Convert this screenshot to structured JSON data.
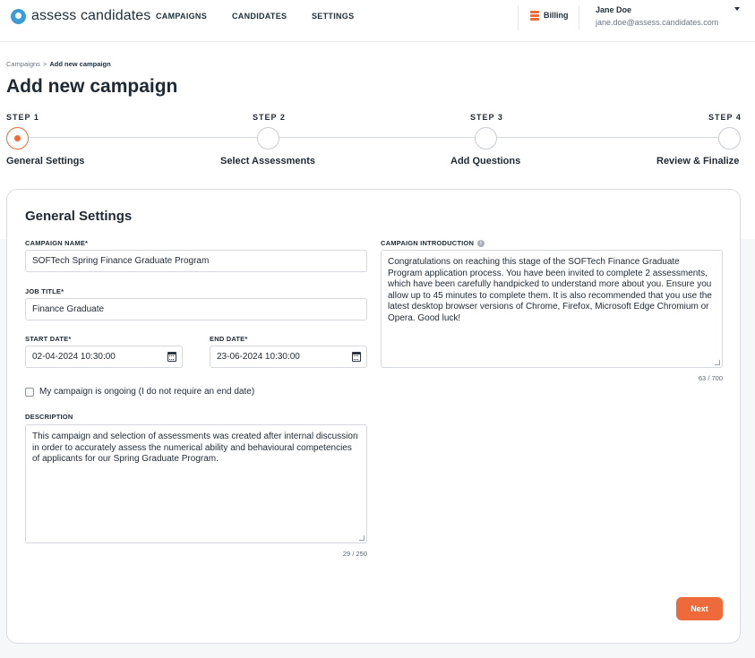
{
  "header": {
    "logo_text": "assess candidates",
    "nav": [
      "CAMPAIGNS",
      "CANDIDATES",
      "SETTINGS"
    ],
    "billing_label": "Billing",
    "user_name": "Jane Doe",
    "user_email": "jane.doe@assess.candidates.com",
    "accent_color": "#ef6a3a",
    "logo_color": "#3d9bd8"
  },
  "breadcrumb": {
    "parent": "Campaigns",
    "separator": ">",
    "current": "Add new campaign"
  },
  "page_title": "Add new campaign",
  "stepper": {
    "steps": [
      {
        "number": "STEP 1",
        "label": "General Settings",
        "state": "active"
      },
      {
        "number": "STEP 2",
        "label": "Select Assessments",
        "state": "pending"
      },
      {
        "number": "STEP 3",
        "label": "Add Questions",
        "state": "pending"
      },
      {
        "number": "STEP 4",
        "label": "Review & Finalize",
        "state": "pending"
      }
    ]
  },
  "form": {
    "title": "General Settings",
    "campaign_name": {
      "label": "CAMPAIGN NAME*",
      "value": "SOFTech Spring Finance Graduate Program"
    },
    "job_title": {
      "label": "JOB TITLE*",
      "value": "Finance Graduate"
    },
    "start_date": {
      "label": "START DATE*",
      "value": "02-04-2024 10:30:00",
      "icon": "calendar-icon"
    },
    "end_date": {
      "label": "END DATE*",
      "value": "23-06-2024 10:30:00",
      "icon": "calendar-icon"
    },
    "ongoing": {
      "label": "My campaign is ongoing (I do not require an end date)",
      "checked": false
    },
    "description": {
      "label": "DESCRIPTION",
      "value": "This campaign and selection of assessments was created after internal discussion in order to accurately assess the numerical ability and behavioural competencies of applicants for our Spring Graduate Program.",
      "counter": "29 / 250"
    },
    "introduction": {
      "label": "CAMPAIGN INTRODUCTION",
      "icon": "info-icon",
      "value": "Congratulations on reaching this stage of the SOFTech Finance Graduate Program application process. You have been invited to complete 2 assessments, which have been carefully handpicked to understand more about you. Ensure you allow up to 45 minutes to complete them. It is also recommended that you use the latest desktop browser versions of Chrome, Firefox, Microsoft Edge Chromium or Opera. Good luck!",
      "counter": "63 / 700"
    },
    "next_label": "Next"
  }
}
